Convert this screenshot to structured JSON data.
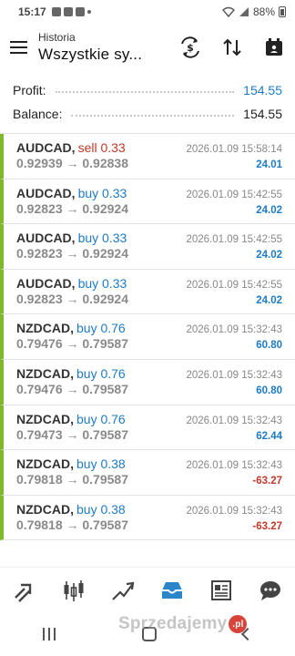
{
  "status_bar": {
    "time": "15:17",
    "battery": "88%"
  },
  "header": {
    "subtitle": "Historia",
    "title": "Wszystkie sy...",
    "icons": [
      "menu-icon",
      "currency-exchange-icon",
      "sort-icon",
      "calendar-icon"
    ]
  },
  "summary": {
    "profit_label": "Profit:",
    "profit_value": "154.55",
    "balance_label": "Balance:",
    "balance_value": "154.55"
  },
  "trades": [
    {
      "symbol": "AUDCAD,",
      "side": "sell 0.33",
      "side_type": "sell",
      "prices": "0.92939 → 0.92838",
      "time": "2026.01.09 15:58:14",
      "profit": "24.01",
      "profit_sign": "pos"
    },
    {
      "symbol": "AUDCAD,",
      "side": "buy 0.33",
      "side_type": "buy",
      "prices": "0.92823 → 0.92924",
      "time": "2026.01.09 15:42:55",
      "profit": "24.02",
      "profit_sign": "pos"
    },
    {
      "symbol": "AUDCAD,",
      "side": "buy 0.33",
      "side_type": "buy",
      "prices": "0.92823 → 0.92924",
      "time": "2026.01.09 15:42:55",
      "profit": "24.02",
      "profit_sign": "pos"
    },
    {
      "symbol": "AUDCAD,",
      "side": "buy 0.33",
      "side_type": "buy",
      "prices": "0.92823 → 0.92924",
      "time": "2026.01.09 15:42:55",
      "profit": "24.02",
      "profit_sign": "pos"
    },
    {
      "symbol": "NZDCAD,",
      "side": "buy 0.76",
      "side_type": "buy",
      "prices": "0.79476 → 0.79587",
      "time": "2026.01.09 15:32:43",
      "profit": "60.80",
      "profit_sign": "pos"
    },
    {
      "symbol": "NZDCAD,",
      "side": "buy 0.76",
      "side_type": "buy",
      "prices": "0.79476 → 0.79587",
      "time": "2026.01.09 15:32:43",
      "profit": "60.80",
      "profit_sign": "pos"
    },
    {
      "symbol": "NZDCAD,",
      "side": "buy 0.76",
      "side_type": "buy",
      "prices": "0.79473 → 0.79587",
      "time": "2026.01.09 15:32:43",
      "profit": "62.44",
      "profit_sign": "pos"
    },
    {
      "symbol": "NZDCAD,",
      "side": "buy 0.38",
      "side_type": "buy",
      "prices": "0.79818 → 0.79587",
      "time": "2026.01.09 15:32:43",
      "profit": "-63.27",
      "profit_sign": "neg"
    },
    {
      "symbol": "NZDCAD,",
      "side": "buy 0.38",
      "side_type": "buy",
      "prices": "0.79818 → 0.79587",
      "time": "2026.01.09 15:32:43",
      "profit": "-63.27",
      "profit_sign": "neg"
    }
  ],
  "bottom_nav": [
    "quotes-icon",
    "chart-icon",
    "trade-icon",
    "history-icon",
    "news-icon",
    "messages-icon"
  ],
  "watermark": {
    "text": "Sprzedajemy",
    "badge": ".pl"
  },
  "colors": {
    "accent_blue": "#1e7bc4",
    "sell_red": "#c0392b",
    "side_bar_green": "#7fb82a"
  }
}
